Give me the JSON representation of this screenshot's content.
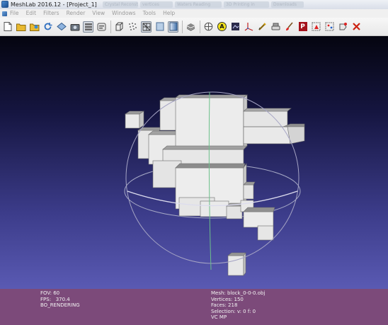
{
  "window": {
    "title": "MeshLab 2016.12 - [Project_1]"
  },
  "background_tabs": [
    "",
    "Crystal Reconstr.",
    "vertices",
    "Waters Reading",
    "3D Printing in",
    "Downloads"
  ],
  "menu": [
    "File",
    "Edit",
    "Filters",
    "Render",
    "View",
    "Windows",
    "Tools",
    "Help"
  ],
  "toolbar": {
    "a_label": "A",
    "p_label": "P"
  },
  "info": {
    "fov": "FOV: 60",
    "fps": "FPS:   370.4",
    "mode": "BO_RENDERING",
    "mesh": "Mesh: block_0-0-0.obj",
    "vertices": "Vertices: 150",
    "faces": "Faces: 218",
    "selection": "Selection: v: 0 f: 0",
    "vc": "VC MP"
  }
}
